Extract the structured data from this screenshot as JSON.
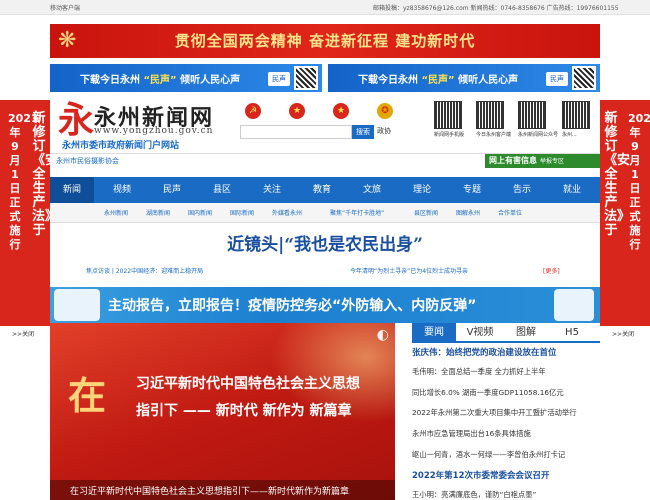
{
  "topbar": {
    "left": "移动客户端",
    "right": "邮箱投稿：yz8358676@126.com 新闻热线：0746-8358676 广告热线：19976601155"
  },
  "banner_top": {
    "text": "贯彻全国两会精神 奋进新征程 建功新时代"
  },
  "banner_download": [
    {
      "prefix": "下载今日永州",
      "highlight": "“民声”",
      "suffix": "倾听人民心声",
      "badge": "民声"
    },
    {
      "prefix": "下载今日永州",
      "highlight": "“民声”",
      "suffix": "倾听人民心声",
      "badge": "民声"
    }
  ],
  "couplet": {
    "left_col1": "新修订《安全生产法》于",
    "left_col2": "2021年9月1日正式施行",
    "right_col1": "新修订《安全生产法》于",
    "right_col2": "2021年9月1日正式施行",
    "close_label": "关闭"
  },
  "logo": {
    "title": "永州新闻网",
    "url": "www.yongzhou.gov.cn",
    "subtitle": "永州市委市政府新闻门户网站"
  },
  "partners": [
    "市委",
    "人大",
    "政府",
    "政协"
  ],
  "search": {
    "placeholder": "",
    "button": "搜索"
  },
  "qrcodes": [
    "新闻网手机版",
    "今日永州客户端",
    "永州新闻网公众号",
    "永州..."
  ],
  "strip": {
    "left": "永州市民俗摄影协会",
    "ad_text": "网上有害信息",
    "ad_sub": "举报专区"
  },
  "nav": [
    "新闻",
    "视频",
    "民声",
    "县区",
    "关注",
    "教育",
    "文旅",
    "理论",
    "专题",
    "告示",
    "就业"
  ],
  "subnav": [
    "永州新闻",
    "湖南新闻",
    "国内新闻",
    "国际新闻",
    "外媒看永州",
    "聚焦“千年打卡胜地”",
    "县区新闻",
    "图解永州",
    "合作单位"
  ],
  "headline": {
    "title": "近镜头|“我也是农民出身”",
    "left_sub": "焦点访谈 | 2022中国经济：迎难而上稳开局",
    "right_sub": "今年清明“为烈士寻亲”已为4位烈士成功寻亲",
    "more": "[更多]"
  },
  "banner_epidemic": {
    "text": "主动报告，立即报告！疫情防控务必“外防输入、内防反弹”"
  },
  "feature": {
    "big": "在",
    "line1": "习近平新时代中国特色社会主义思想",
    "line2": "指引下 —— 新时代 新作为 新篇章",
    "caption": "在习近平新时代中国特色社会主义思想指引下——新时代新作为新篇章"
  },
  "tabs": [
    "要闻",
    "V视频",
    "图解",
    "H5"
  ],
  "news": [
    {
      "text": "张庆伟：始终把党的政治建设放在首位",
      "bold": true
    },
    {
      "text": "毛伟明：全面总结一季度 全力抓好上半年",
      "bold": false
    },
    {
      "text": "同比增长6.0% 湖南一季度GDP11058.16亿元",
      "bold": false
    },
    {
      "text": "2022年永州第二次重大项目集中开工暨扩活动举行",
      "bold": false
    },
    {
      "text": "永州市应急管理局出台16条具体措施",
      "bold": false
    },
    {
      "text": "岖山一何青，浯水一何绿——李曾伯永州打卡记",
      "bold": false
    },
    {
      "text": "2022年第12次市委常委会会议召开",
      "bold": true
    },
    {
      "text": "王小明：亮满廉底色，谨防“白袍点墨”",
      "bold": false
    }
  ],
  "colors": {
    "primary_blue": "#1a6bc4",
    "party_red": "#d9261c",
    "gold": "#fde38a"
  }
}
